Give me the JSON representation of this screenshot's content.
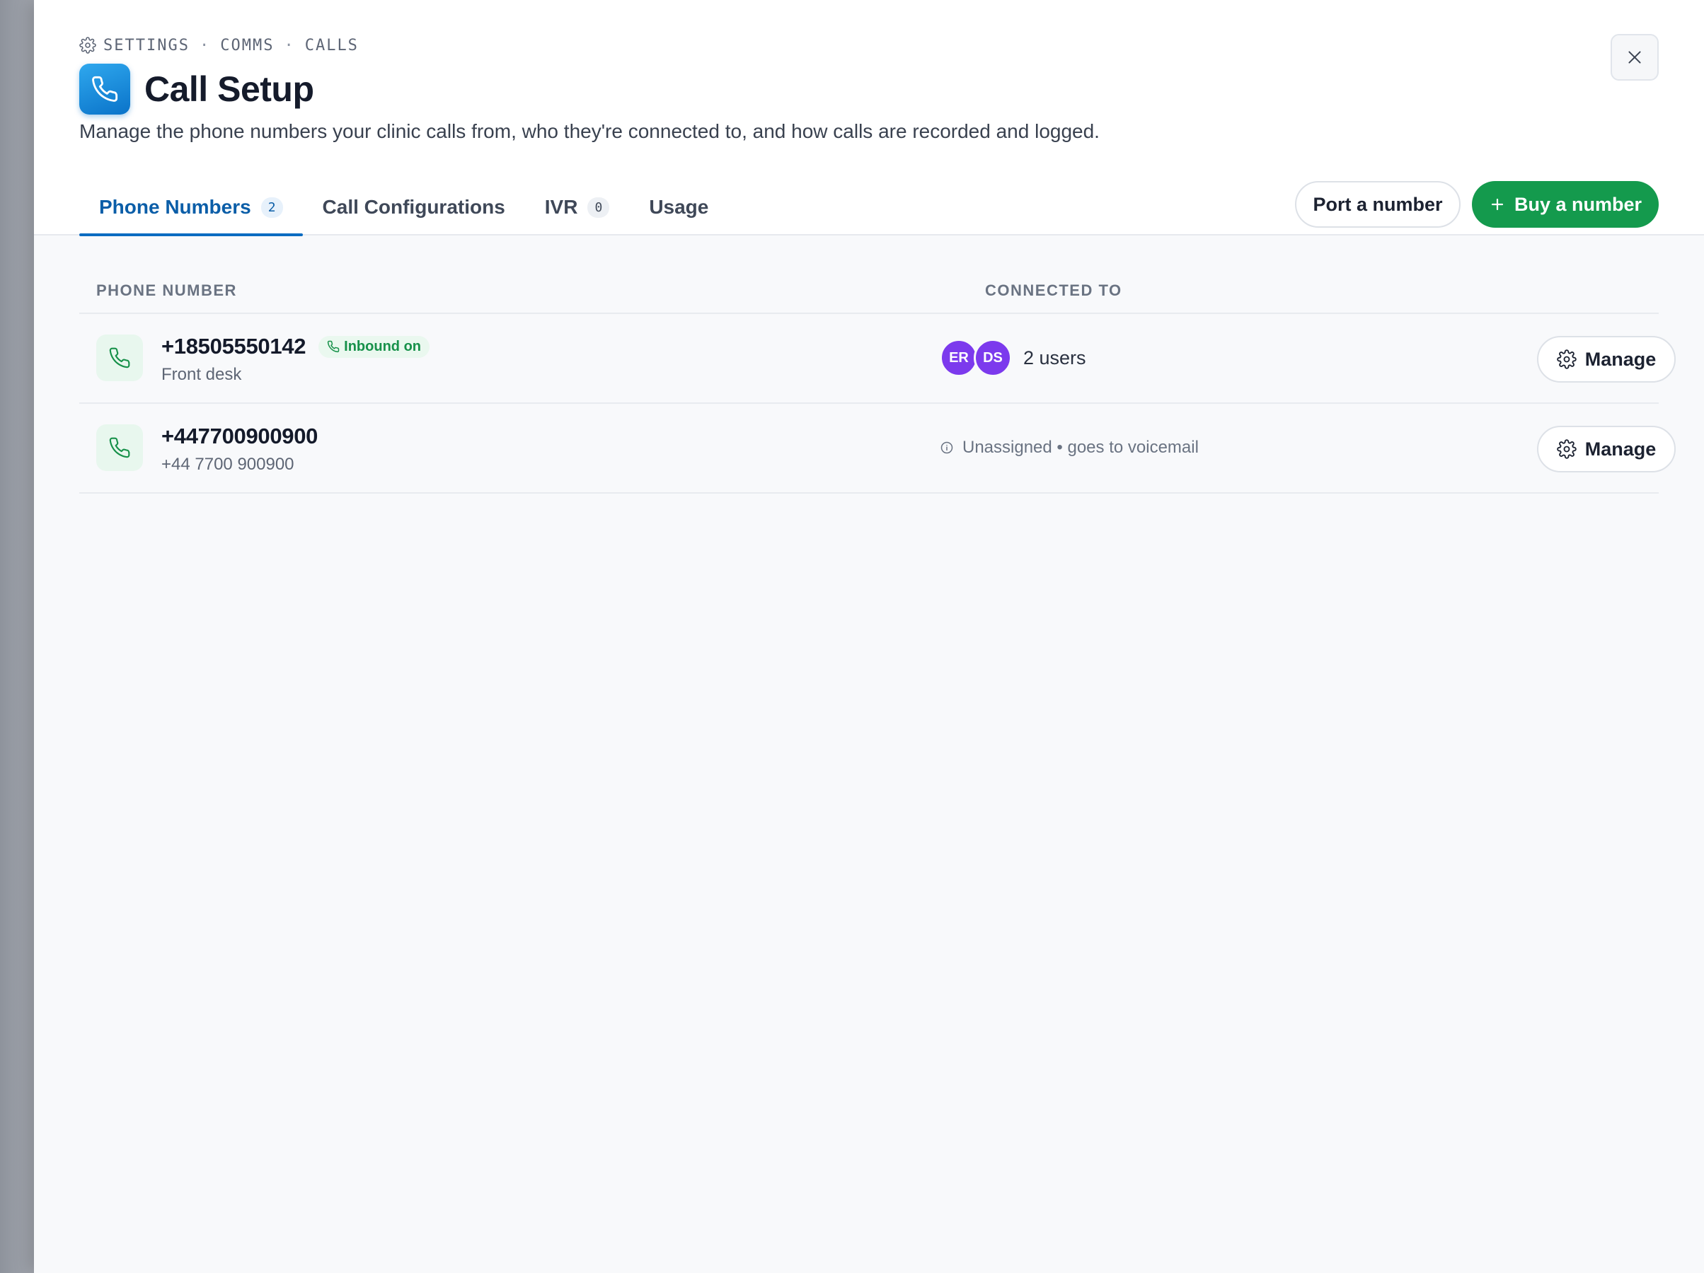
{
  "breadcrumb": {
    "items": [
      "SETTINGS",
      "COMMS",
      "CALLS"
    ],
    "separator": "·",
    "icon": "gear-icon"
  },
  "header": {
    "title": "Call Setup",
    "title_icon": "phone-icon",
    "subtitle": "Manage the phone numbers your clinic calls from, who they're connected to, and how calls are recorded and logged.",
    "close_icon": "close-icon"
  },
  "tabs": [
    {
      "label": "Phone Numbers",
      "count": "2",
      "active": true
    },
    {
      "label": "Call Configurations"
    },
    {
      "label": "IVR",
      "count": "0"
    },
    {
      "label": "Usage"
    }
  ],
  "actions": {
    "port_label": "Port a number",
    "buy_label": "Buy a number",
    "buy_icon": "plus-icon"
  },
  "table": {
    "columns": [
      "PHONE NUMBER",
      "CONNECTED TO"
    ],
    "rows": [
      {
        "number": "+18505550142",
        "badge": "Inbound on",
        "label": "Front desk",
        "connected": {
          "avatars": [
            "ER",
            "DS"
          ],
          "text": "2 users"
        },
        "action": "Manage"
      },
      {
        "number": "+447700900900",
        "label": "+44 7700 900900",
        "connected": {
          "text": "Unassigned • goes to voicemail"
        },
        "action": "Manage"
      }
    ]
  },
  "colors": {
    "accent_blue": "#0b6cc1",
    "primary_green": "#149a4d",
    "avatar_purple": "#7c3aed",
    "badge_green": "#17914a"
  }
}
